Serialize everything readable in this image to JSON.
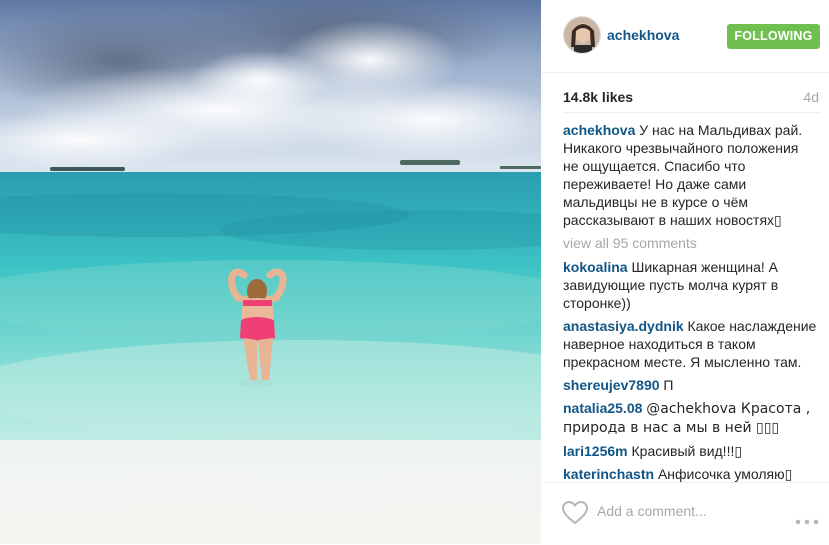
{
  "post": {
    "username": "achekhova",
    "follow_label": "FOLLOWING",
    "likes": "14.8k likes",
    "time": "4d"
  },
  "comments": [
    {
      "user": "achekhova",
      "text": "У нас на Мальдивах рай. Никакого чрезвычайного положения не ощущается. Спасибо что переживаете! Но даже сами мальдивцы не в курсе о чём рассказывают в наших новостях▯"
    },
    {
      "user": "kokoalina",
      "text": "Шикарная женщина! А завидующие пусть молча курят в сторонке))"
    },
    {
      "user": "anastasiya.dydnik",
      "text": "Какое наслаждение наверное находиться в таком прекрасном месте. Я мысленно там."
    },
    {
      "user": "shereujev7890",
      "text": "П"
    },
    {
      "user": "natalia25.08",
      "text": "@achekhova Красота , природа в нас а мы в ней ▯▯▯"
    },
    {
      "user": "lari1256m",
      "text": "Красивый вид!!!▯"
    },
    {
      "user": "katerinchastn",
      "text": "Анфисочка умоляю▯ разместите инфу про ребеночка @mashonka_korozora_sos ее"
    }
  ],
  "view_all": "view all 95 comments",
  "footer": {
    "add_comment_placeholder": "Add a comment..."
  },
  "icons": {
    "like": "heart-icon",
    "more": "more-options-icon"
  },
  "colors": {
    "username": "#125688",
    "follow_button": "#70c050",
    "muted": "#a5a7aa"
  }
}
